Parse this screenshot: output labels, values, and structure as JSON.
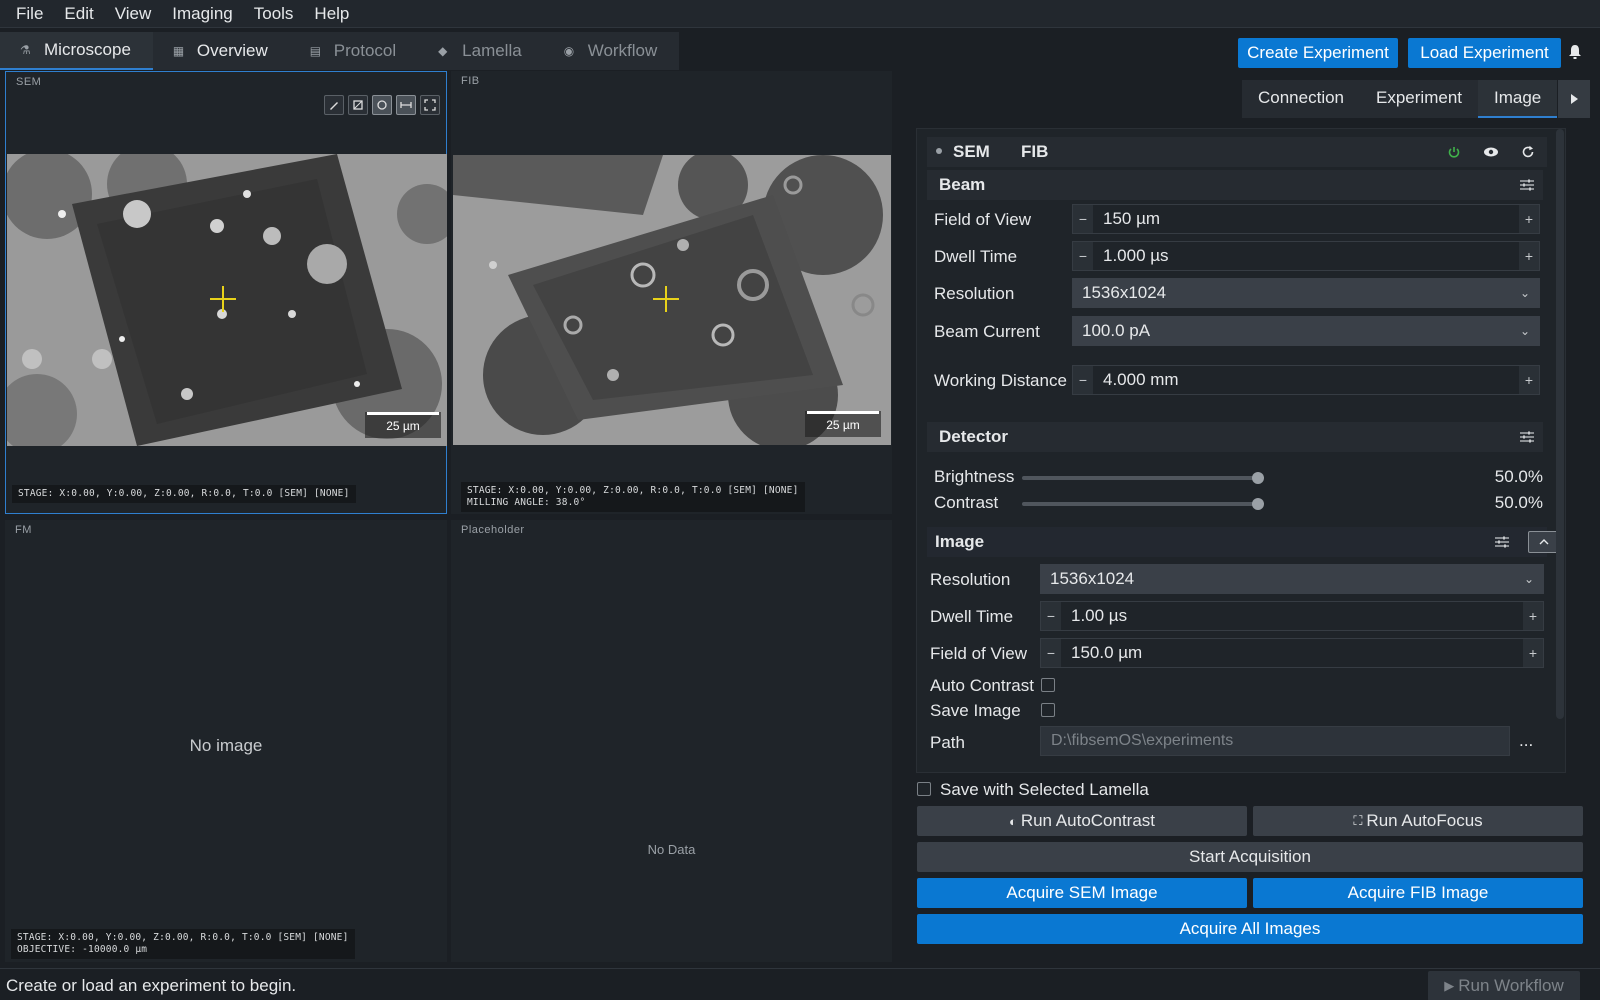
{
  "menu": [
    "File",
    "Edit",
    "View",
    "Imaging",
    "Tools",
    "Help"
  ],
  "tabs": [
    {
      "label": "Microscope",
      "icon": "microscope-icon"
    },
    {
      "label": "Overview",
      "icon": "map-icon"
    },
    {
      "label": "Protocol",
      "icon": "document-icon"
    },
    {
      "label": "Lamella",
      "icon": "layers-icon"
    },
    {
      "label": "Workflow",
      "icon": "play-circle-icon"
    }
  ],
  "header": {
    "create_experiment": "Create Experiment",
    "load_experiment": "Load Experiment"
  },
  "viewers": {
    "sem": {
      "label": "SEM",
      "scale": "25 µm",
      "stage": "STAGE: X:0.00, Y:0.00, Z:0.00, R:0.0, T:0.0 [SEM] [NONE]"
    },
    "fib": {
      "label": "FIB",
      "scale": "25 µm",
      "stage": "STAGE: X:0.00, Y:0.00, Z:0.00, R:0.0, T:0.0 [SEM] [NONE]",
      "milling": "MILLING ANGLE: 38.0°"
    },
    "fm": {
      "label": "FM",
      "empty": "No image",
      "stage": "STAGE: X:0.00, Y:0.00, Z:0.00, R:0.0, T:0.0 [SEM] [NONE]",
      "objective": "OBJECTIVE: -10000.0 µm"
    },
    "placeholder": {
      "label": "Placeholder",
      "empty": "No Data"
    }
  },
  "subtabs": [
    "Connection",
    "Experiment",
    "Image"
  ],
  "beam_type": {
    "sem": "SEM",
    "fib": "FIB"
  },
  "beam": {
    "title": "Beam",
    "fov_label": "Field of View",
    "fov": "150 µm",
    "dwell_label": "Dwell Time",
    "dwell": "1.000 µs",
    "resolution_label": "Resolution",
    "resolution": "1536x1024",
    "current_label": "Beam Current",
    "current": "100.0 pA",
    "wd_label": "Working Distance",
    "wd": "4.000 mm"
  },
  "detector": {
    "title": "Detector",
    "brightness_label": "Brightness",
    "brightness": "50.0%",
    "contrast_label": "Contrast",
    "contrast": "50.0%"
  },
  "image": {
    "title": "Image",
    "resolution_label": "Resolution",
    "resolution": "1536x1024",
    "dwell_label": "Dwell Time",
    "dwell": "1.00 µs",
    "fov_label": "Field of View",
    "fov": "150.0 µm",
    "auto_contrast_label": "Auto Contrast",
    "save_image_label": "Save Image",
    "path_label": "Path",
    "path": "D:\\fibsemOS\\experiments",
    "browse": "..."
  },
  "save_with_lamella": "Save with Selected Lamella",
  "actions": {
    "autocontrast": "Run AutoContrast",
    "autofocus": "Run AutoFocus",
    "start_acquisition": "Start Acquisition",
    "acquire_sem": "Acquire SEM Image",
    "acquire_fib": "Acquire FIB Image",
    "acquire_all": "Acquire All Images"
  },
  "status": {
    "message": "Create or load an experiment to begin.",
    "run_workflow": "Run Workflow"
  },
  "colors": {
    "accent": "#0a78d2",
    "crosshair": "#e8d21a",
    "power": "#3fb14a"
  }
}
